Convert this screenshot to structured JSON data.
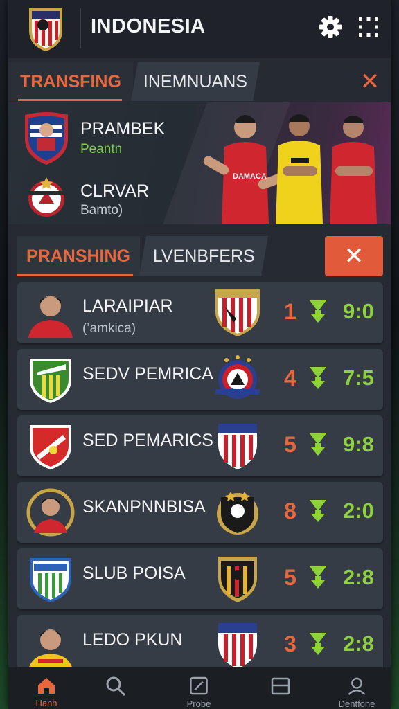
{
  "header": {
    "title": "INDONESIA"
  },
  "top_tabs": {
    "active": "TRANSFING",
    "inactive": "INEMNUANS"
  },
  "feature": {
    "player1": {
      "name": "PRAMBEK",
      "sub": "Peantn"
    },
    "player2": {
      "name": "CLRVAR",
      "sub": "Bamto)"
    },
    "shirt_text": "DAMACA"
  },
  "list_tabs": {
    "active": "PRANSHING",
    "inactive": "LVENBFERS"
  },
  "rows": [
    {
      "name": "LARAIPIAR",
      "sub": "(’amkica)",
      "rank": "1",
      "score": "9:0"
    },
    {
      "name": "SEDV PEMRICA",
      "sub": "",
      "rank": "4",
      "score": "7:5"
    },
    {
      "name": "SED PEMARICS",
      "sub": "",
      "rank": "5",
      "score": "9:8"
    },
    {
      "name": "SKANPNNBISA",
      "sub": "",
      "rank": "8",
      "score": "2:0"
    },
    {
      "name": "SLUB POISA",
      "sub": "",
      "rank": "5",
      "score": "2:8"
    },
    {
      "name": "LEDO PKUN",
      "sub": "",
      "rank": "3",
      "score": "2:8"
    }
  ],
  "nav": {
    "items": [
      "Hanh",
      "",
      "Probe",
      "",
      "Dentfone"
    ]
  },
  "icons": {
    "settings": "gear-icon",
    "menu": "grid-dots-icon",
    "close": "close-icon",
    "trend": "down-arrow-icon"
  },
  "colors": {
    "accent": "#e8673f",
    "score": "#8fd13c",
    "arrow": "#8fd13c"
  }
}
